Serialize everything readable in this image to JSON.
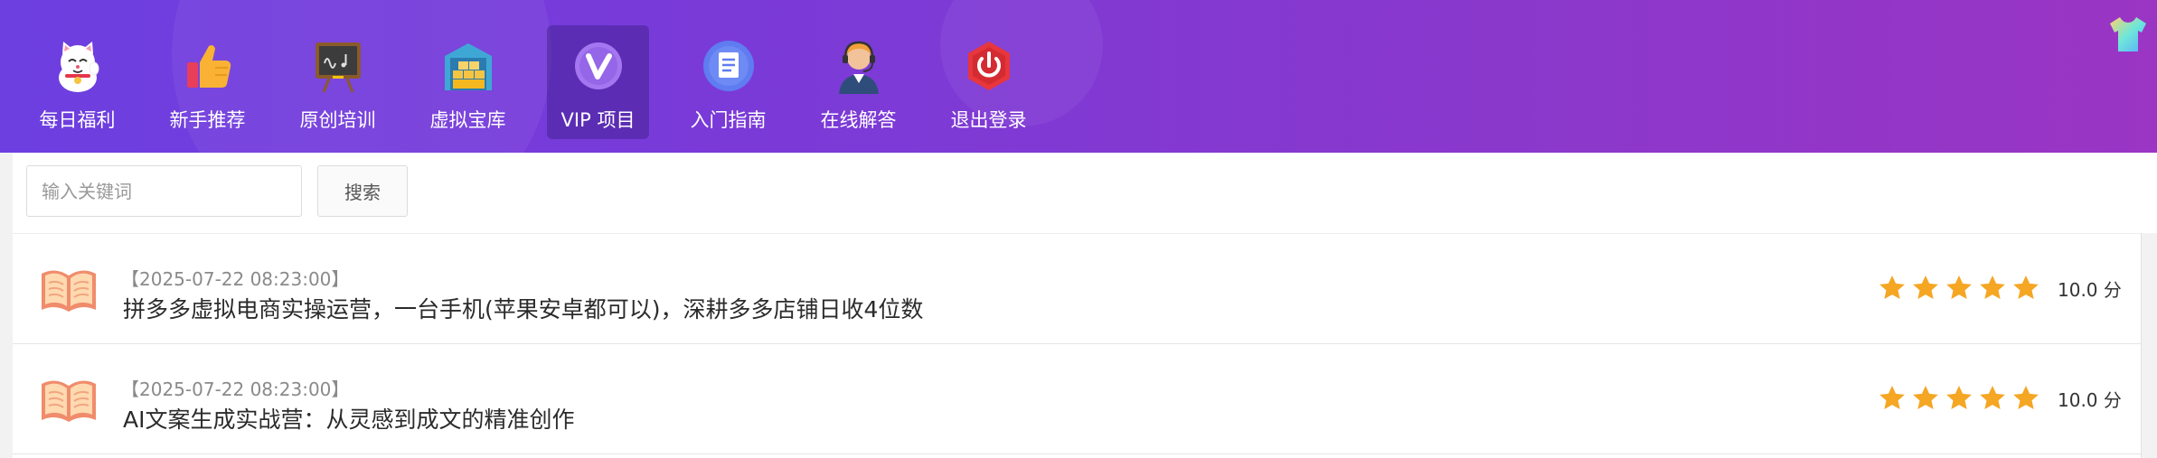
{
  "nav": {
    "items": [
      {
        "label": "每日福利",
        "icon": "lucky-cat-icon"
      },
      {
        "label": "新手推荐",
        "icon": "thumbs-up-icon"
      },
      {
        "label": "原创培训",
        "icon": "chalkboard-icon"
      },
      {
        "label": "虚拟宝库",
        "icon": "treasure-vault-icon"
      },
      {
        "label": "VIP 项目",
        "icon": "vip-badge-icon",
        "active": true
      },
      {
        "label": "入门指南",
        "icon": "document-icon"
      },
      {
        "label": "在线解答",
        "icon": "support-agent-icon"
      },
      {
        "label": "退出登录",
        "icon": "power-icon"
      }
    ]
  },
  "header": {
    "skin_icon": "tshirt-skin-icon"
  },
  "search": {
    "placeholder": "输入关键词",
    "button_label": "搜索"
  },
  "list": {
    "items": [
      {
        "time": "【2025-07-22 08:23:00】",
        "title": "拼多多虚拟电商实操运营，一台手机(苹果安卓都可以)，深耕多多店铺日收4位数",
        "stars": 5,
        "score": "10.0 分"
      },
      {
        "time": "【2025-07-22 08:23:00】",
        "title": "AI文案生成实战营：从灵感到成文的精准创作",
        "stars": 5,
        "score": "10.0 分"
      }
    ]
  },
  "colors": {
    "header_start": "#6d3fe0",
    "header_end": "#9a35c4",
    "star": "#f5a623",
    "book": "#f08c6c"
  }
}
